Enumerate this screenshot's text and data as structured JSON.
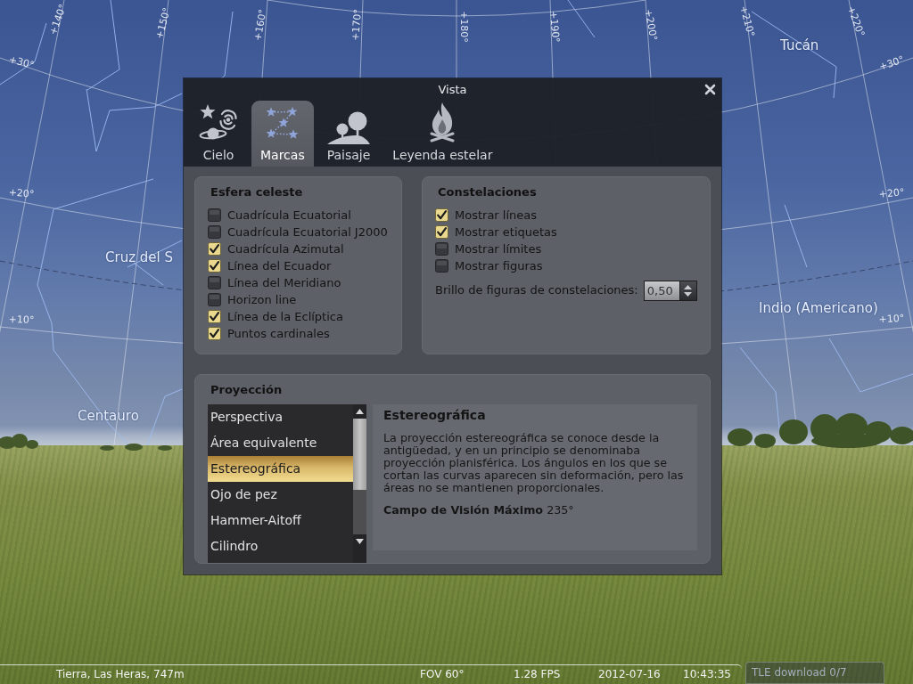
{
  "sky": {
    "longitude_labels": [
      "+140°",
      "+150°",
      "+160°",
      "+170°",
      "+180°",
      "+190°",
      "+200°",
      "+210°",
      "+220°"
    ],
    "latitude_labels": [
      "+30°",
      "+30°",
      "+20°",
      "+20°",
      "+10°",
      "+10°"
    ],
    "constellation_labels": [
      "Tucán",
      "Cruz del S",
      "Indio (Americano)",
      "Centauro"
    ]
  },
  "dialog": {
    "title": "Vista",
    "tabs": [
      {
        "label": "Cielo",
        "selected": false
      },
      {
        "label": "Marcas",
        "selected": true
      },
      {
        "label": "Paisaje",
        "selected": false
      },
      {
        "label": "Leyenda estelar",
        "selected": false
      }
    ],
    "celestial_sphere": {
      "title": "Esfera celeste",
      "options": [
        {
          "label": "Cuadrícula Ecuatorial",
          "checked": false
        },
        {
          "label": "Cuadrícula Ecuatorial J2000",
          "checked": false
        },
        {
          "label": "Cuadrícula Azimutal",
          "checked": true
        },
        {
          "label": "Línea del Ecuador",
          "checked": true
        },
        {
          "label": "Línea del Meridiano",
          "checked": false
        },
        {
          "label": "Horizon line",
          "checked": false
        },
        {
          "label": "Línea de la Eclíptica",
          "checked": true
        },
        {
          "label": "Puntos cardinales",
          "checked": true
        }
      ]
    },
    "constellations": {
      "title": "Constelaciones",
      "options": [
        {
          "label": "Mostrar líneas",
          "checked": true
        },
        {
          "label": "Mostrar etiquetas",
          "checked": true
        },
        {
          "label": "Mostrar límites",
          "checked": false
        },
        {
          "label": "Mostrar figuras",
          "checked": false
        }
      ],
      "brightness": {
        "label": "Brillo de figuras de constelaciones:",
        "value": "0,50"
      }
    },
    "projection": {
      "title": "Proyección",
      "items": [
        {
          "label": "Perspectiva",
          "selected": false
        },
        {
          "label": "Área equivalente",
          "selected": false
        },
        {
          "label": "Estereográfica",
          "selected": true
        },
        {
          "label": "Ojo de pez",
          "selected": false
        },
        {
          "label": "Hammer-Aitoff",
          "selected": false
        },
        {
          "label": "Cilindro",
          "selected": false
        }
      ],
      "description": {
        "title": "Estereográfica",
        "text": "La proyección estereográfica se conoce desde la antigüedad, y en un principio se denominaba proyección planisférica. Los ángulos en los que se cortan las curvas aparecen sin deformación, pero las áreas no se mantienen proporcionales.",
        "max_fov": "**Campo de Visión Máximo** 235°"
      }
    }
  },
  "status_bar": {
    "location": "Tierra, Las Heras, 747m",
    "fov": "FOV 60°",
    "fps": "1.28 FPS",
    "date": "2012-07-16",
    "time": "10:43:35",
    "download": "TLE download 0/7"
  }
}
